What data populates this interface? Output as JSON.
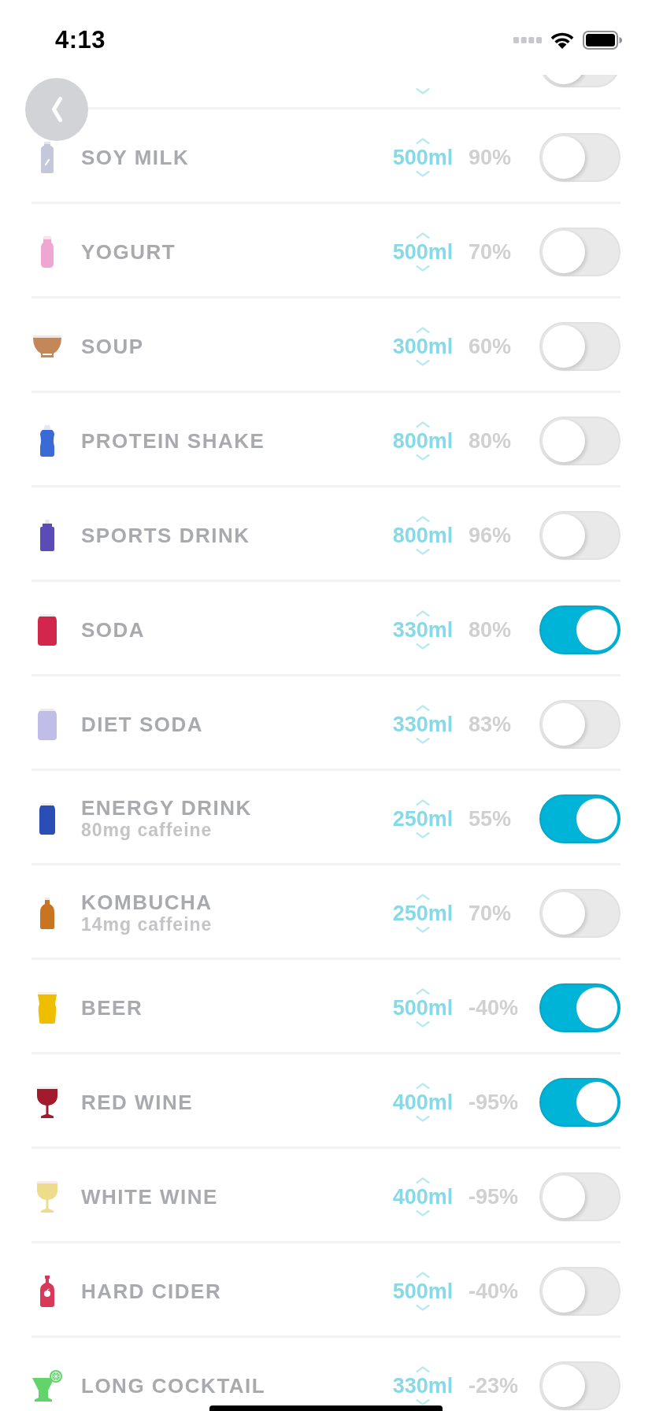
{
  "status_bar": {
    "time": "4:13"
  },
  "partial_row": {
    "on": false
  },
  "rows": [
    {
      "kind": "bottle",
      "color": "#c5c8da",
      "name": "SOY MILK",
      "amount": "500ml",
      "percent": "90%",
      "on": false
    },
    {
      "kind": "yogurt",
      "color": "#f0a6d2",
      "name": "YOGURT",
      "amount": "500ml",
      "percent": "70%",
      "on": false
    },
    {
      "kind": "bowl",
      "color": "#c4875a",
      "name": "SOUP",
      "amount": "300ml",
      "percent": "60%",
      "on": false
    },
    {
      "kind": "shaker",
      "color": "#3a6ad4",
      "name": "PROTEIN SHAKE",
      "amount": "800ml",
      "percent": "80%",
      "on": false
    },
    {
      "kind": "sports_bottle",
      "color": "#5b4bb6",
      "name": "SPORTS DRINK",
      "amount": "800ml",
      "percent": "96%",
      "on": false
    },
    {
      "kind": "can",
      "color": "#d2264a",
      "name": "SODA",
      "amount": "330ml",
      "percent": "80%",
      "on": true
    },
    {
      "kind": "can",
      "color": "#c0bde8",
      "name": "DIET SODA",
      "amount": "330ml",
      "percent": "83%",
      "on": false
    },
    {
      "kind": "slim_can",
      "color": "#2a4db6",
      "name": "ENERGY DRINK",
      "note": "80mg caffeine",
      "amount": "250ml",
      "percent": "55%",
      "on": true
    },
    {
      "kind": "jug",
      "color": "#c87420",
      "name": "KOMBUCHA",
      "note": "14mg caffeine",
      "amount": "250ml",
      "percent": "70%",
      "on": false
    },
    {
      "kind": "pint",
      "color": "#f0be00",
      "name": "BEER",
      "amount": "500ml",
      "percent": "-40%",
      "on": true
    },
    {
      "kind": "wine_glass",
      "color": "#a31a2c",
      "name": "RED WINE",
      "amount": "400ml",
      "percent": "-95%",
      "on": true
    },
    {
      "kind": "wine_glass",
      "color": "#ecdc8c",
      "name": "WHITE WINE",
      "amount": "400ml",
      "percent": "-95%",
      "on": false
    },
    {
      "kind": "cider_bottle",
      "color": "#d8385a",
      "name": "HARD CIDER",
      "amount": "500ml",
      "percent": "-40%",
      "on": false
    },
    {
      "kind": "cocktail",
      "color": "#62d46c",
      "name": "LONG COCKTAIL",
      "amount": "330ml",
      "percent": "-23%",
      "on": false
    }
  ]
}
